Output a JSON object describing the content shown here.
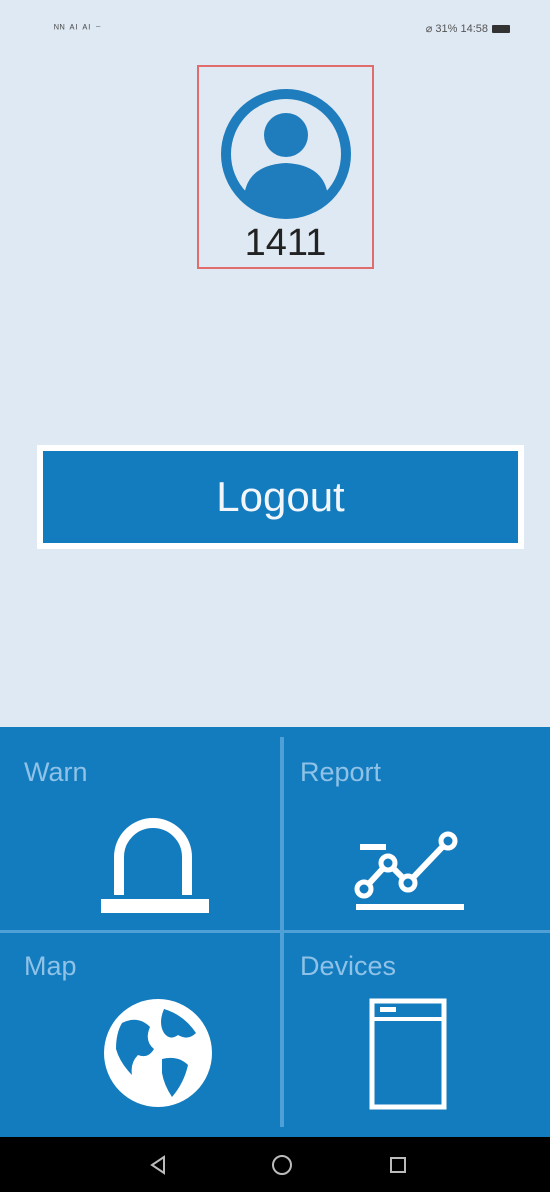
{
  "status_bar": {
    "left": "ᴺᴺ ᴬᴵ ᴬᴵ ⁻",
    "right": "⌀ 31% 14:58"
  },
  "user": {
    "id": "1411"
  },
  "logout_label": "Logout",
  "menu": [
    {
      "label": "Warn",
      "icon": "siren-icon"
    },
    {
      "label": "Report",
      "icon": "chart-icon"
    },
    {
      "label": "Map",
      "icon": "globe-icon"
    },
    {
      "label": "Devices",
      "icon": "device-icon"
    }
  ],
  "colors": {
    "background": "#dfe9f3",
    "primary": "#137cbf",
    "highlight": "#e06c6c"
  }
}
